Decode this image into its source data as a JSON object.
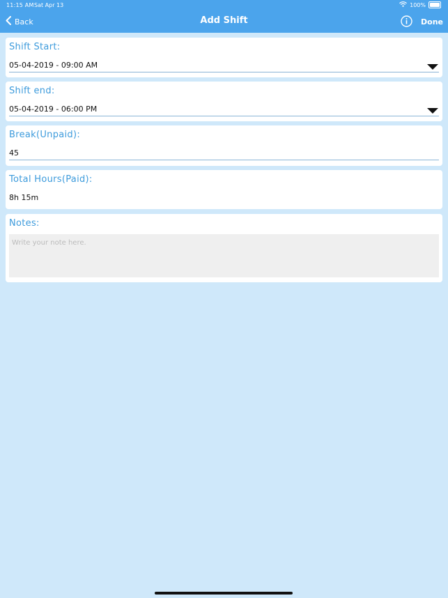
{
  "status_bar": {
    "time": "11:15 AM",
    "date": "Sat Apr 13",
    "battery": "100%"
  },
  "nav": {
    "back_label": "Back",
    "title": "Add Shift",
    "done_label": "Done"
  },
  "form": {
    "shift_start": {
      "label": "Shift Start:",
      "value": "05-04-2019 - 09:00 AM"
    },
    "shift_end": {
      "label": "Shift end:",
      "value": "05-04-2019 - 06:00 PM"
    },
    "break": {
      "label": "Break(Unpaid):",
      "value": "45"
    },
    "total_hours": {
      "label": "Total Hours(Paid):",
      "value": "8h 15m"
    },
    "notes": {
      "label": "Notes:",
      "placeholder": "Write your note here."
    }
  },
  "colors": {
    "nav_background": "#4ba4ec",
    "page_background": "#cfe8fa",
    "label_color": "#3d9bdc"
  }
}
